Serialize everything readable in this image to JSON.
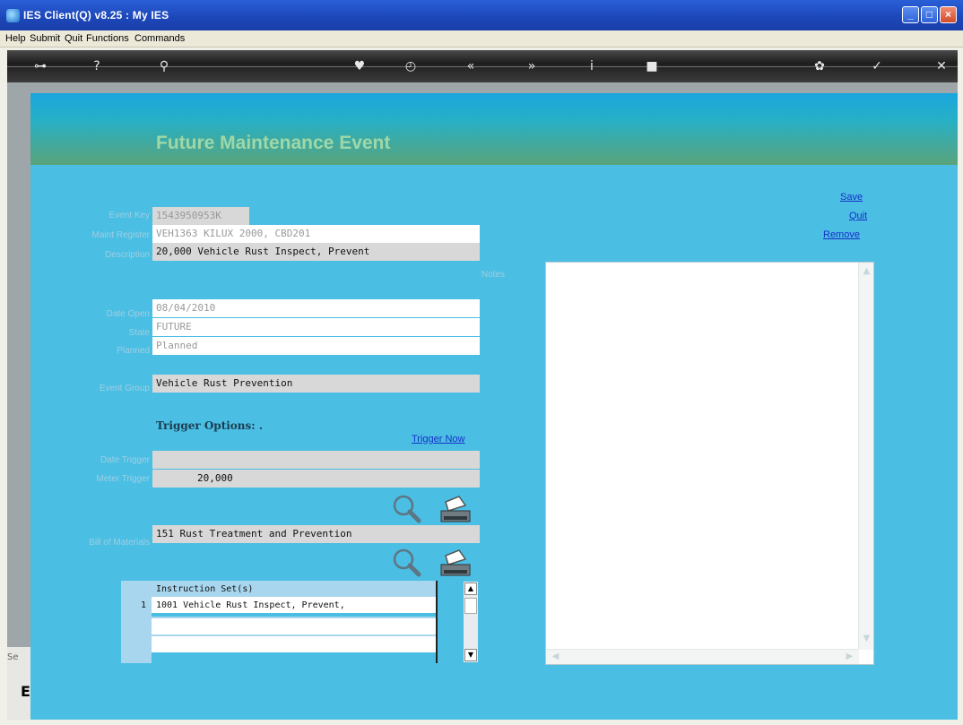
{
  "window": {
    "title": "IES Client(Q) v8.25 : My IES"
  },
  "menu": [
    "Help",
    "Submit",
    "Quit",
    "Functions",
    "Commands"
  ],
  "toolbar_icons": [
    "key-icon",
    "help-icon",
    "search-icon",
    "heart-icon",
    "clock-icon",
    "rewind-icon",
    "forward-icon",
    "info-icon",
    "stop-icon",
    "settings-icon",
    "check-icon",
    "close-icon"
  ],
  "page": {
    "title": "Future Maintenance Event"
  },
  "actions": {
    "save": "Save",
    "quit": "Quit",
    "remove": "Remove",
    "trigger_now": "Trigger Now"
  },
  "form": {
    "event_key": {
      "label": "Event Key",
      "value": "1543950953K"
    },
    "maint_register": {
      "label": "Maint Register",
      "value": "VEH1363 KILUX 2000, CBD201"
    },
    "description": {
      "label": "Description",
      "value": "20,000 Vehicle Rust Inspect, Prevent"
    },
    "date_open": {
      "label": "Date Open",
      "value": "08/04/2010"
    },
    "state": {
      "label": "State",
      "value": "FUTURE"
    },
    "planned": {
      "label": "Planned",
      "value": "Planned"
    },
    "event_group": {
      "label": "Event Group",
      "value": "Vehicle Rust Prevention"
    },
    "trigger_title": "Trigger Options: .",
    "date_trigger": {
      "label": "Date Trigger",
      "value": ""
    },
    "meter_trigger": {
      "label": "Meter Trigger",
      "value": "20,000"
    },
    "bill_of_materials": {
      "label": "Bill of Materials",
      "value": "151 Rust Treatment and Prevention"
    },
    "notes_label": "Notes"
  },
  "instruction_grid": {
    "header": "Instruction Set(s)",
    "rows": [
      {
        "num": "1",
        "text": "1001 Vehicle Rust Inspect, Prevent,"
      }
    ]
  },
  "left_strip": {
    "text1": "Se",
    "text2": "E"
  },
  "colors": {
    "accent": "#4bbee4",
    "title": "#9fd8a8",
    "link": "#1530c8"
  }
}
